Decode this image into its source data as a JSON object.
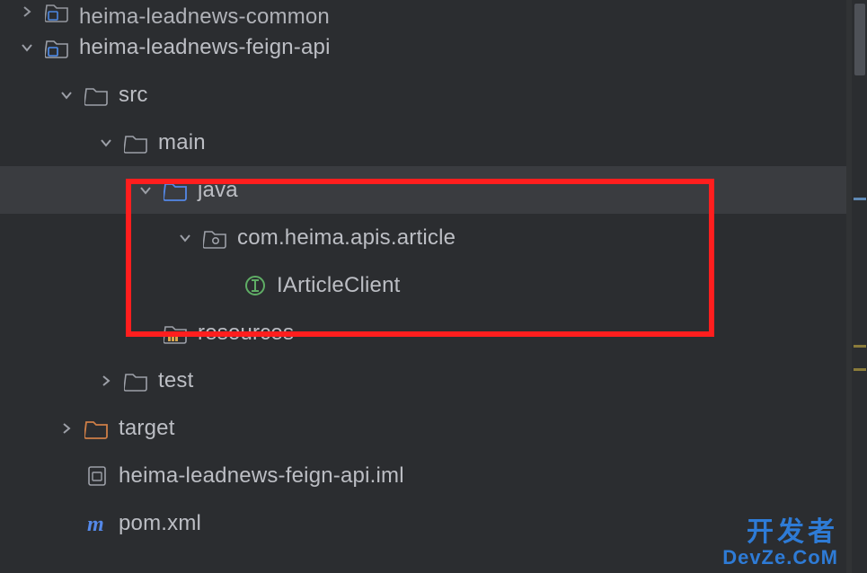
{
  "tree": [
    {
      "indent": 1,
      "arrow": "right",
      "icon": "module-folder",
      "label": "heima-leadnews-common",
      "cut": "top"
    },
    {
      "indent": 1,
      "arrow": "down",
      "icon": "module-folder",
      "label": "heima-leadnews-feign-api"
    },
    {
      "indent": 2,
      "arrow": "down",
      "icon": "folder",
      "label": "src"
    },
    {
      "indent": 3,
      "arrow": "down",
      "icon": "folder",
      "label": "main"
    },
    {
      "indent": 4,
      "arrow": "down",
      "icon": "src-folder",
      "label": "java",
      "selected": true
    },
    {
      "indent": 5,
      "arrow": "down",
      "icon": "package",
      "label": "com.heima.apis.article"
    },
    {
      "indent": 6,
      "arrow": "none",
      "icon": "interface",
      "label": "IArticleClient"
    },
    {
      "indent": 4,
      "arrow": "none",
      "icon": "res-folder",
      "label": "resources"
    },
    {
      "indent": 3,
      "arrow": "right",
      "icon": "folder",
      "label": "test"
    },
    {
      "indent": 2,
      "arrow": "right",
      "icon": "target-folder",
      "label": "target"
    },
    {
      "indent": 2,
      "arrow": "none",
      "icon": "iml-file",
      "label": "heima-leadnews-feign-api.iml"
    },
    {
      "indent": 2,
      "arrow": "none",
      "icon": "maven",
      "label": "pom.xml"
    }
  ],
  "watermark": {
    "cn": "开发者",
    "en": "DevZe.CoM"
  }
}
